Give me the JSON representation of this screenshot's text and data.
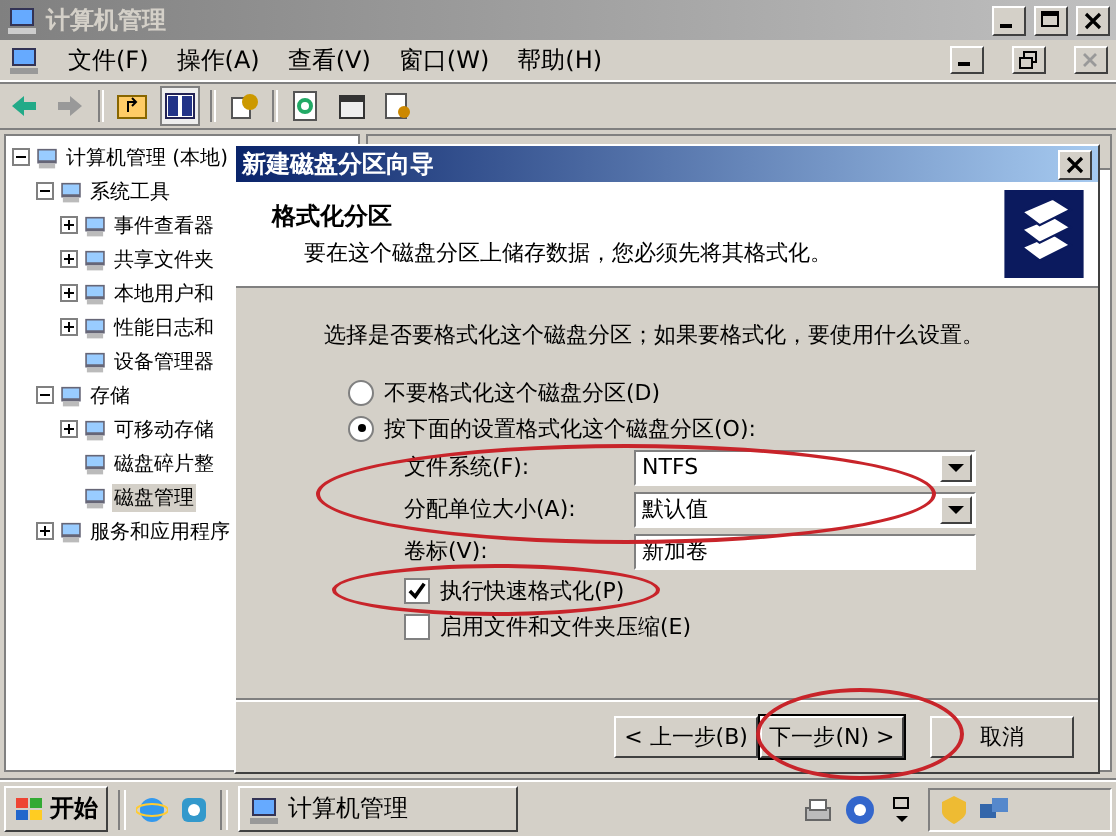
{
  "window": {
    "title": "计算机管理"
  },
  "menu": [
    {
      "label": "文件(F)"
    },
    {
      "label": "操作(A)"
    },
    {
      "label": "查看(V)"
    },
    {
      "label": "窗口(W)"
    },
    {
      "label": "帮助(H)"
    }
  ],
  "tree": [
    {
      "label": "计算机管理 (本地)",
      "selected": false,
      "expanded": true,
      "children": [
        {
          "label": "系统工具",
          "selected": false,
          "expanded": true,
          "children": [
            {
              "label": "事件查看器",
              "selected": false,
              "expanded": false
            },
            {
              "label": "共享文件夹",
              "selected": false,
              "expanded": false
            },
            {
              "label": "本地用户和",
              "selected": false,
              "expanded": false
            },
            {
              "label": "性能日志和",
              "selected": false,
              "expanded": false
            },
            {
              "label": "设备管理器",
              "selected": false
            }
          ]
        },
        {
          "label": "存储",
          "selected": false,
          "expanded": true,
          "children": [
            {
              "label": "可移动存储",
              "selected": false,
              "expanded": false
            },
            {
              "label": "磁盘碎片整",
              "selected": false
            },
            {
              "label": "磁盘管理",
              "selected": true
            }
          ]
        },
        {
          "label": "服务和应用程序",
          "selected": false,
          "expanded": false
        }
      ]
    }
  ],
  "dialog": {
    "title": "新建磁盘分区向导",
    "heading": "格式化分区",
    "subtitle": "要在这个磁盘分区上储存数据，您必须先将其格式化。",
    "prompt": "选择是否要格式化这个磁盘分区；如果要格式化，要使用什么设置。",
    "radios": [
      {
        "label": "不要格式化这个磁盘分区(D)",
        "selected": false
      },
      {
        "label": "按下面的设置格式化这个磁盘分区(O):",
        "selected": true
      }
    ],
    "fields": [
      {
        "label": "文件系统(F):",
        "kind": "dropdown",
        "value": "NTFS"
      },
      {
        "label": "分配单位大小(A):",
        "kind": "dropdown",
        "value": "默认值"
      },
      {
        "label": "卷标(V):",
        "kind": "text",
        "value": "新加卷"
      }
    ],
    "checkboxes": [
      {
        "label": "执行快速格式化(P)",
        "checked": true
      },
      {
        "label": "启用文件和文件夹压缩(E)",
        "checked": false
      }
    ],
    "buttons": [
      {
        "label": "< 上一步(B)",
        "default": false
      },
      {
        "label": "下一步(N) >",
        "default": true
      },
      {
        "label": "取消",
        "default": false
      }
    ]
  },
  "taskbar": {
    "start": "开始",
    "tasks": [
      {
        "label": "计算机管理",
        "selected": false
      }
    ]
  }
}
